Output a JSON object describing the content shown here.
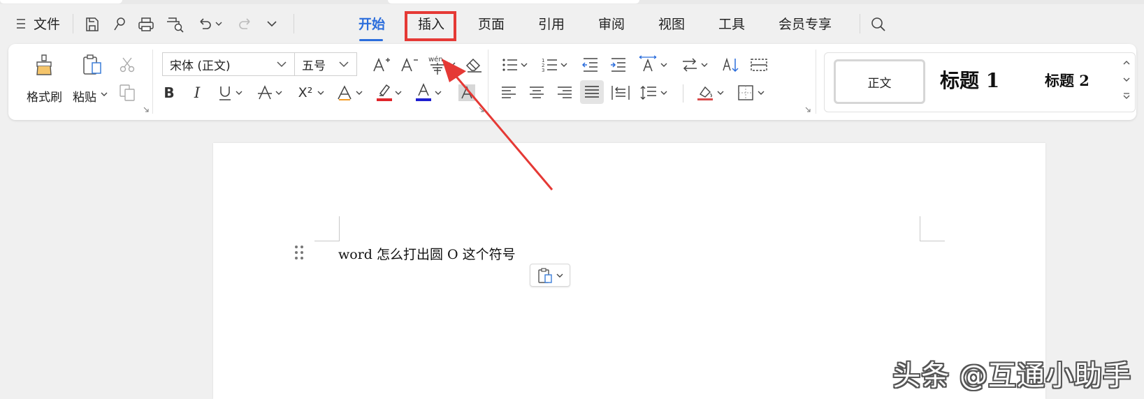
{
  "menu": {
    "file_label": "文件",
    "tabs": [
      {
        "label": "开始",
        "active": true
      },
      {
        "label": "插入",
        "highlighted": true
      },
      {
        "label": "页面"
      },
      {
        "label": "引用"
      },
      {
        "label": "审阅"
      },
      {
        "label": "视图"
      },
      {
        "label": "工具"
      },
      {
        "label": "会员专享"
      }
    ]
  },
  "ribbon": {
    "format_painter_label": "格式刷",
    "paste_label": "粘贴",
    "font_name": "宋体 (正文)",
    "font_size": "五号",
    "phonetic_glyph": "wén",
    "superscript_label": "X²",
    "styles": {
      "normal": "正文",
      "heading1": "标题 1",
      "heading2": "标题 2"
    }
  },
  "document": {
    "text": "word 怎么打出圆 O 这个符号"
  },
  "watermark": "头条 @互通小助手",
  "colors": {
    "accent": "#2b6ddc",
    "highlight_red": "#e53935",
    "highlight_color_bar": "#e0262b",
    "font_color_bar": "#1f1fd0"
  }
}
